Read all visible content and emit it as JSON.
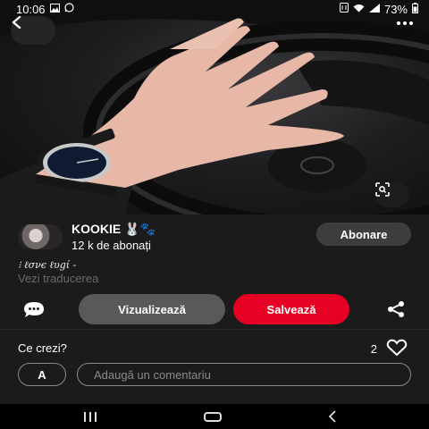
{
  "status_bar": {
    "time": "10:06",
    "battery": "73%",
    "left_icons": [
      "image-icon",
      "whatsapp-icon"
    ],
    "right_icons": [
      "nfc-icon",
      "wifi-icon",
      "signal-icon",
      "battery-icon"
    ]
  },
  "pin": {
    "image": "photo of hand with wristwatch on steering wheel",
    "author": {
      "name": "KOOKIE 🐰🐾",
      "subscribers": "12 k de abonați",
      "follow_label": "Abonare"
    },
    "description": "⁝ ℓσνє ℓυgί -",
    "translate_label": "Vezi traducerea",
    "actions": {
      "view_label": "Vizualizează",
      "save_label": "Salvează"
    },
    "comments": {
      "prompt": "Ce crezi?",
      "like_count": "2",
      "avatar_letter": "A",
      "input_placeholder": "Adaugă un comentariu"
    }
  },
  "colors": {
    "accent_red": "#e60023",
    "background": "#1b1b1b",
    "button_gray": "#595959",
    "follow_gray": "#3d3d3d"
  }
}
